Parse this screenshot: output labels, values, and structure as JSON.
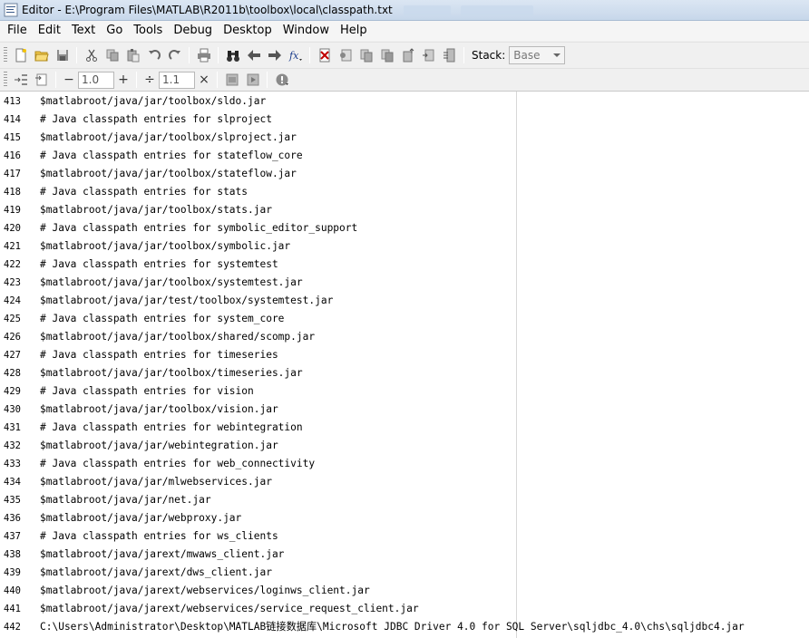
{
  "window": {
    "title": "Editor - E:\\Program Files\\MATLAB\\R2011b\\toolbox\\local\\classpath.txt"
  },
  "menu": [
    "File",
    "Edit",
    "Text",
    "Go",
    "Tools",
    "Debug",
    "Desktop",
    "Window",
    "Help"
  ],
  "toolbar": {
    "icons": [
      "new-file-icon",
      "open-folder-icon",
      "save-icon",
      "cut-icon",
      "copy-icon",
      "paste-icon",
      "undo-icon",
      "redo-icon",
      "print-icon",
      "find-binoculars-icon",
      "back-arrow-icon",
      "forward-arrow-icon",
      "function-icon",
      "clear-breakpoints-icon",
      "set-breakpoint-icon",
      "step-icon",
      "step-in-icon",
      "step-out-icon",
      "exit-debug-icon"
    ],
    "stack_label": "Stack:",
    "stack_value": "Base"
  },
  "cell_toolbar": {
    "minus": "−",
    "value1": "1.0",
    "plus": "+",
    "divide": "÷",
    "value2": "1.1",
    "times": "×"
  },
  "lines": [
    {
      "n": "413",
      "text": "$matlabroot/java/jar/toolbox/sldo.jar"
    },
    {
      "n": "414",
      "text": "# Java classpath entries for slproject"
    },
    {
      "n": "415",
      "text": "$matlabroot/java/jar/toolbox/slproject.jar"
    },
    {
      "n": "416",
      "text": "# Java classpath entries for stateflow_core"
    },
    {
      "n": "417",
      "text": "$matlabroot/java/jar/toolbox/stateflow.jar"
    },
    {
      "n": "418",
      "text": "# Java classpath entries for stats"
    },
    {
      "n": "419",
      "text": "$matlabroot/java/jar/toolbox/stats.jar"
    },
    {
      "n": "420",
      "text": "# Java classpath entries for symbolic_editor_support"
    },
    {
      "n": "421",
      "text": "$matlabroot/java/jar/toolbox/symbolic.jar"
    },
    {
      "n": "422",
      "text": "# Java classpath entries for systemtest"
    },
    {
      "n": "423",
      "text": "$matlabroot/java/jar/toolbox/systemtest.jar"
    },
    {
      "n": "424",
      "text": "$matlabroot/java/jar/test/toolbox/systemtest.jar"
    },
    {
      "n": "425",
      "text": "# Java classpath entries for system_core"
    },
    {
      "n": "426",
      "text": "$matlabroot/java/jar/toolbox/shared/scomp.jar"
    },
    {
      "n": "427",
      "text": "# Java classpath entries for timeseries"
    },
    {
      "n": "428",
      "text": "$matlabroot/java/jar/toolbox/timeseries.jar"
    },
    {
      "n": "429",
      "text": "# Java classpath entries for vision"
    },
    {
      "n": "430",
      "text": "$matlabroot/java/jar/toolbox/vision.jar"
    },
    {
      "n": "431",
      "text": "# Java classpath entries for webintegration"
    },
    {
      "n": "432",
      "text": "$matlabroot/java/jar/webintegration.jar"
    },
    {
      "n": "433",
      "text": "# Java classpath entries for web_connectivity"
    },
    {
      "n": "434",
      "text": "$matlabroot/java/jar/mlwebservices.jar"
    },
    {
      "n": "435",
      "text": "$matlabroot/java/jar/net.jar"
    },
    {
      "n": "436",
      "text": "$matlabroot/java/jar/webproxy.jar"
    },
    {
      "n": "437",
      "text": "# Java classpath entries for ws_clients"
    },
    {
      "n": "438",
      "text": "$matlabroot/java/jarext/mwaws_client.jar"
    },
    {
      "n": "439",
      "text": "$matlabroot/java/jarext/dws_client.jar"
    },
    {
      "n": "440",
      "text": "$matlabroot/java/jarext/webservices/loginws_client.jar"
    },
    {
      "n": "441",
      "text": "$matlabroot/java/jarext/webservices/service_request_client.jar"
    },
    {
      "n": "442",
      "text": "C:\\Users\\Administrator\\Desktop\\MATLAB链接数据库\\Microsoft JDBC Driver 4.0 for SQL Server\\sqljdbc_4.0\\chs\\sqljdbc4.jar"
    }
  ]
}
